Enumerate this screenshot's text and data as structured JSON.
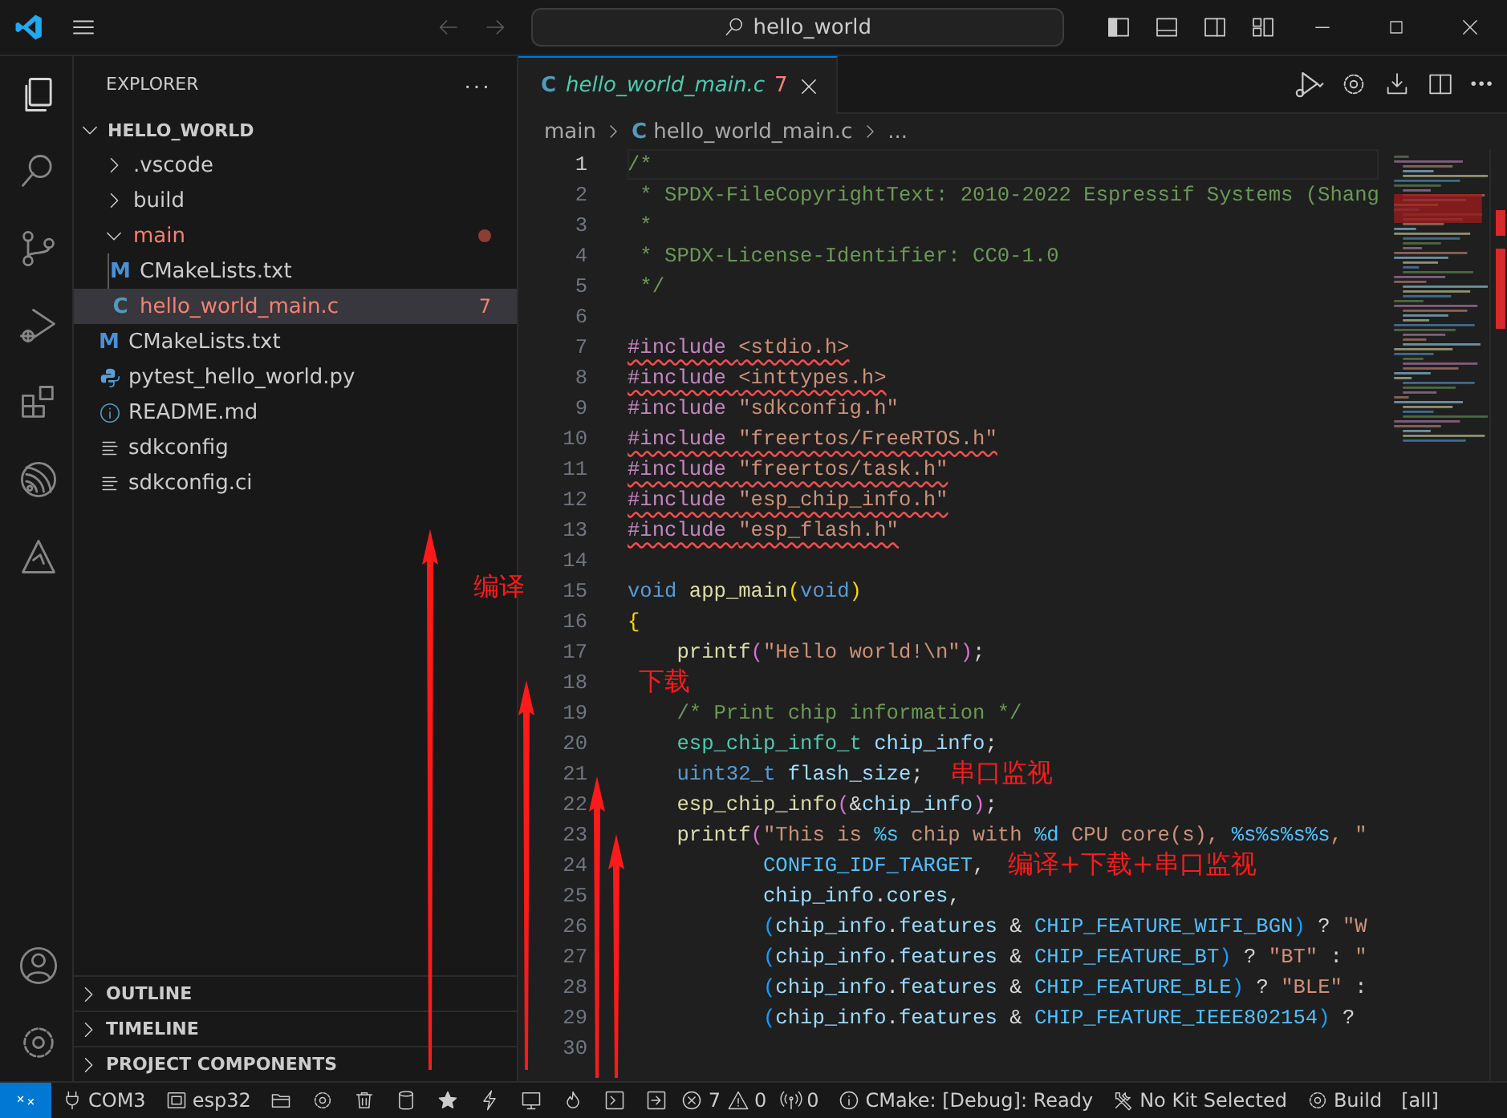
{
  "title_bar": {
    "search": "hello_world",
    "nav_disabled": true
  },
  "activity_bar": {
    "top": [
      {
        "kind": "files",
        "selected": true
      },
      {
        "kind": "search",
        "selected": false
      },
      {
        "kind": "source-control",
        "selected": false
      },
      {
        "kind": "run-debug",
        "selected": false
      },
      {
        "kind": "extensions",
        "selected": false
      },
      {
        "kind": "espressif",
        "selected": false
      },
      {
        "kind": "idf",
        "selected": false
      }
    ],
    "bottom": [
      {
        "kind": "account"
      },
      {
        "kind": "settings"
      }
    ]
  },
  "sidebar": {
    "title": "EXPLORER",
    "more": "···",
    "folder": {
      "label": "HELLO_WORLD",
      "expanded": true
    },
    "tree": [
      {
        "label": ".vscode",
        "kind": "folder",
        "expanded": false,
        "selected": false,
        "problem": false
      },
      {
        "label": "build",
        "kind": "folder",
        "expanded": false,
        "selected": false,
        "problem": false
      },
      {
        "label": "main",
        "kind": "folder",
        "expanded": true,
        "selected": false,
        "problem": true,
        "children": [
          {
            "label": "CMakeLists.txt",
            "kind": "cmake",
            "glyph": "M",
            "selected": false,
            "problem": false
          },
          {
            "label": "hello_world_main.c",
            "kind": "c",
            "glyph": "C",
            "selected": true,
            "problem": true,
            "badge": "7"
          }
        ]
      },
      {
        "label": "CMakeLists.txt",
        "kind": "cmake",
        "glyph": "M",
        "selected": false,
        "problem": false
      },
      {
        "label": "pytest_hello_world.py",
        "kind": "python",
        "selected": false,
        "problem": false
      },
      {
        "label": "README.md",
        "kind": "info",
        "selected": false,
        "problem": false
      },
      {
        "label": "sdkconfig",
        "kind": "lines",
        "selected": false,
        "problem": false
      },
      {
        "label": "sdkconfig.ci",
        "kind": "lines",
        "selected": false,
        "problem": false
      }
    ],
    "sections": [
      {
        "label": "OUTLINE",
        "expanded": false
      },
      {
        "label": "TIMELINE",
        "expanded": false
      },
      {
        "label": "PROJECT COMPONENTS",
        "expanded": false
      }
    ]
  },
  "editor": {
    "tabs": [
      {
        "glyph": "C",
        "label": "hello_world_main.c",
        "badge": "7",
        "selected": true,
        "problem": true,
        "preview": true
      }
    ],
    "breadcrumb": [
      {
        "label": "main"
      },
      {
        "glyph": "C",
        "label": "hello_world_main.c"
      },
      {
        "label": "..."
      }
    ],
    "lines": [
      {
        "number": "1",
        "current": true,
        "squiggle": false,
        "tokens": [
          {
            "kind": "c",
            "text": "/*"
          }
        ]
      },
      {
        "number": "2",
        "current": false,
        "squiggle": false,
        "tokens": [
          {
            "kind": "c",
            "text": " * SPDX-FileCopyrightText: 2010-2022 Espressif Systems (Shang"
          }
        ]
      },
      {
        "number": "3",
        "current": false,
        "squiggle": false,
        "tokens": [
          {
            "kind": "c",
            "text": " *"
          }
        ]
      },
      {
        "number": "4",
        "current": false,
        "squiggle": false,
        "tokens": [
          {
            "kind": "c",
            "text": " * SPDX-License-Identifier: CC0-1.0"
          }
        ]
      },
      {
        "number": "5",
        "current": false,
        "squiggle": false,
        "tokens": [
          {
            "kind": "c",
            "text": " */"
          }
        ]
      },
      {
        "number": "6",
        "current": false
      },
      {
        "number": "7",
        "current": false,
        "squiggle": true,
        "tokens": [
          {
            "kind": "p",
            "text": "#include "
          },
          {
            "kind": "s",
            "text": "<stdio.h>"
          }
        ]
      },
      {
        "number": "8",
        "current": false,
        "squiggle": true,
        "tokens": [
          {
            "kind": "p",
            "text": "#include "
          },
          {
            "kind": "s",
            "text": "<inttypes.h>"
          }
        ]
      },
      {
        "number": "9",
        "current": false,
        "squiggle": false,
        "tokens": [
          {
            "kind": "p",
            "text": "#include "
          },
          {
            "kind": "s",
            "text": "\"sdkconfig.h\""
          }
        ]
      },
      {
        "number": "10",
        "current": false,
        "squiggle": true,
        "tokens": [
          {
            "kind": "p",
            "text": "#include "
          },
          {
            "kind": "s",
            "text": "\"freertos/FreeRTOS.h\""
          }
        ]
      },
      {
        "number": "11",
        "current": false,
        "squiggle": true,
        "tokens": [
          {
            "kind": "p",
            "text": "#include "
          },
          {
            "kind": "s",
            "text": "\"freertos/task.h\""
          }
        ]
      },
      {
        "number": "12",
        "current": false,
        "squiggle": true,
        "tokens": [
          {
            "kind": "p",
            "text": "#include "
          },
          {
            "kind": "s",
            "text": "\"esp_chip_info.h\""
          }
        ]
      },
      {
        "number": "13",
        "current": false,
        "squiggle": true,
        "tokens": [
          {
            "kind": "p",
            "text": "#include "
          },
          {
            "kind": "s",
            "text": "\"esp_flash.h\""
          }
        ]
      },
      {
        "number": "14",
        "current": false
      },
      {
        "number": "15",
        "current": false,
        "squiggle": false,
        "tokens": [
          {
            "kind": "k",
            "text": "void "
          },
          {
            "kind": "f",
            "text": "app_main"
          },
          {
            "kind": "b1",
            "text": "("
          },
          {
            "kind": "k",
            "text": "void"
          },
          {
            "kind": "b1",
            "text": ")"
          }
        ]
      },
      {
        "number": "16",
        "current": false,
        "squiggle": false,
        "tokens": [
          {
            "kind": "b1",
            "text": "{"
          }
        ]
      },
      {
        "number": "17",
        "current": false,
        "squiggle": false,
        "tokens": [
          {
            "kind": "f",
            "text": "    printf"
          },
          {
            "kind": "b2",
            "text": "("
          },
          {
            "kind": "s",
            "text": "\"Hello world!\\n\""
          },
          {
            "kind": "b2",
            "text": ")"
          },
          {
            "kind": "o",
            "text": ";"
          }
        ]
      },
      {
        "number": "18",
        "current": false
      },
      {
        "number": "19",
        "current": false,
        "squiggle": false,
        "tokens": [
          {
            "kind": "c",
            "text": "    /* Print chip information */"
          }
        ]
      },
      {
        "number": "20",
        "current": false,
        "squiggle": false,
        "tokens": [
          {
            "kind": "t",
            "text": "    esp_chip_info_t "
          },
          {
            "kind": "v",
            "text": "chip_info"
          },
          {
            "kind": "o",
            "text": ";"
          }
        ]
      },
      {
        "number": "21",
        "current": false,
        "squiggle": false,
        "tokens": [
          {
            "kind": "k",
            "text": "    uint32_t "
          },
          {
            "kind": "v",
            "text": "flash_size"
          },
          {
            "kind": "o",
            "text": ";"
          }
        ]
      },
      {
        "number": "22",
        "current": false,
        "squiggle": false,
        "tokens": [
          {
            "kind": "f",
            "text": "    esp_chip_info"
          },
          {
            "kind": "b2",
            "text": "("
          },
          {
            "kind": "o",
            "text": "&"
          },
          {
            "kind": "v",
            "text": "chip_info"
          },
          {
            "kind": "b2",
            "text": ")"
          },
          {
            "kind": "o",
            "text": ";"
          }
        ]
      },
      {
        "number": "23",
        "current": false,
        "squiggle": false,
        "tokens": [
          {
            "kind": "f",
            "text": "    printf"
          },
          {
            "kind": "b2",
            "text": "("
          },
          {
            "kind": "s",
            "text": "\"This is "
          },
          {
            "kind": "m",
            "text": "%s"
          },
          {
            "kind": "s",
            "text": " chip with "
          },
          {
            "kind": "m",
            "text": "%d"
          },
          {
            "kind": "s",
            "text": " CPU core(s), "
          },
          {
            "kind": "m",
            "text": "%s%s%s%s"
          },
          {
            "kind": "s",
            "text": ", \""
          }
        ]
      },
      {
        "number": "24",
        "current": false,
        "squiggle": false,
        "tokens": [
          {
            "kind": "m",
            "text": "           CONFIG_IDF_TARGET"
          },
          {
            "kind": "o",
            "text": ","
          }
        ]
      },
      {
        "number": "25",
        "current": false,
        "squiggle": false,
        "tokens": [
          {
            "kind": "v",
            "text": "           chip_info"
          },
          {
            "kind": "o",
            "text": "."
          },
          {
            "kind": "v",
            "text": "cores"
          },
          {
            "kind": "o",
            "text": ","
          }
        ]
      },
      {
        "number": "26",
        "current": false,
        "squiggle": false,
        "tokens": [
          {
            "kind": "b3",
            "text": "           ("
          },
          {
            "kind": "v",
            "text": "chip_info"
          },
          {
            "kind": "o",
            "text": "."
          },
          {
            "kind": "v",
            "text": "features"
          },
          {
            "kind": "o",
            "text": " & "
          },
          {
            "kind": "m",
            "text": "CHIP_FEATURE_WIFI_BGN"
          },
          {
            "kind": "b3",
            "text": ")"
          },
          {
            "kind": "o",
            "text": " ? "
          },
          {
            "kind": "s",
            "text": "\"W"
          }
        ]
      },
      {
        "number": "27",
        "current": false,
        "squiggle": false,
        "tokens": [
          {
            "kind": "b3",
            "text": "           ("
          },
          {
            "kind": "v",
            "text": "chip_info"
          },
          {
            "kind": "o",
            "text": "."
          },
          {
            "kind": "v",
            "text": "features"
          },
          {
            "kind": "o",
            "text": " & "
          },
          {
            "kind": "m",
            "text": "CHIP_FEATURE_BT"
          },
          {
            "kind": "b3",
            "text": ")"
          },
          {
            "kind": "o",
            "text": " ? "
          },
          {
            "kind": "s",
            "text": "\"BT\""
          },
          {
            "kind": "o",
            "text": " : "
          },
          {
            "kind": "s",
            "text": "\""
          }
        ]
      },
      {
        "number": "28",
        "current": false,
        "squiggle": false,
        "tokens": [
          {
            "kind": "b3",
            "text": "           ("
          },
          {
            "kind": "v",
            "text": "chip_info"
          },
          {
            "kind": "o",
            "text": "."
          },
          {
            "kind": "v",
            "text": "features"
          },
          {
            "kind": "o",
            "text": " & "
          },
          {
            "kind": "m",
            "text": "CHIP_FEATURE_BLE"
          },
          {
            "kind": "b3",
            "text": ")"
          },
          {
            "kind": "o",
            "text": " ? "
          },
          {
            "kind": "s",
            "text": "\"BLE\""
          },
          {
            "kind": "o",
            "text": " :"
          }
        ]
      },
      {
        "number": "29",
        "current": false,
        "squiggle": false,
        "tokens": [
          {
            "kind": "b3",
            "text": "           ("
          },
          {
            "kind": "v",
            "text": "chip_info"
          },
          {
            "kind": "o",
            "text": "."
          },
          {
            "kind": "v",
            "text": "features"
          },
          {
            "kind": "o",
            "text": " & "
          },
          {
            "kind": "m",
            "text": "CHIP_FEATURE_IEEE802154"
          },
          {
            "kind": "b3",
            "text": ")"
          },
          {
            "kind": "o",
            "text": " ?"
          }
        ]
      },
      {
        "number": "30",
        "current": false
      }
    ]
  },
  "status_bar": [
    {
      "kind": "remote"
    },
    {
      "kind": "plug",
      "text": "COM3"
    },
    {
      "kind": "chip",
      "text": "esp32"
    },
    {
      "kind": "folder"
    },
    {
      "kind": "gear"
    },
    {
      "kind": "trash"
    },
    {
      "kind": "database"
    },
    {
      "kind": "star"
    },
    {
      "kind": "bolt"
    },
    {
      "kind": "monitor"
    },
    {
      "kind": "flame"
    },
    {
      "kind": "terminal"
    },
    {
      "kind": "enter"
    },
    {
      "kind": "errors",
      "text": "7"
    },
    {
      "kind": "warnings",
      "text": "0"
    },
    {
      "kind": "antenna",
      "text": "0"
    },
    {
      "kind": "info",
      "text": "CMake: [Debug]: Ready"
    },
    {
      "kind": "tools",
      "text": "No Kit Selected"
    },
    {
      "kind": "gear",
      "text": "Build"
    },
    {
      "kind": "plain",
      "text": "[all]"
    }
  ],
  "annotations": [
    {
      "label": "编译"
    },
    {
      "label": "下载"
    },
    {
      "label": "串口监视"
    },
    {
      "label": "编译+下载+串口监视"
    }
  ]
}
